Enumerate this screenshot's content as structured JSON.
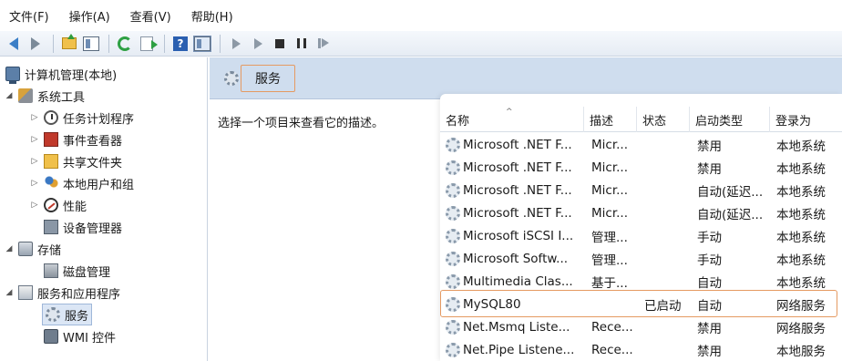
{
  "menu": [
    "文件(F)",
    "操作(A)",
    "查看(V)",
    "帮助(H)"
  ],
  "tree": {
    "root": "计算机管理(本地)",
    "system_tools": "系统工具",
    "task_scheduler": "任务计划程序",
    "event_viewer": "事件查看器",
    "shared_folders": "共享文件夹",
    "local_users": "本地用户和组",
    "performance": "性能",
    "device_manager": "设备管理器",
    "storage": "存储",
    "disk_management": "磁盘管理",
    "services_apps": "服务和应用程序",
    "services": "服务",
    "wmi": "WMI 控件"
  },
  "header": {
    "title": "服务"
  },
  "description_hint": "选择一个项目来查看它的描述。",
  "columns": {
    "name": "名称",
    "description": "描述",
    "status": "状态",
    "startup": "启动类型",
    "logon": "登录为"
  },
  "rows": [
    {
      "name": "Microsoft .NET F...",
      "desc": "Micr...",
      "status": "",
      "startup": "禁用",
      "logon": "本地系统"
    },
    {
      "name": "Microsoft .NET F...",
      "desc": "Micr...",
      "status": "",
      "startup": "禁用",
      "logon": "本地系统"
    },
    {
      "name": "Microsoft .NET F...",
      "desc": "Micr...",
      "status": "",
      "startup": "自动(延迟...",
      "logon": "本地系统"
    },
    {
      "name": "Microsoft .NET F...",
      "desc": "Micr...",
      "status": "",
      "startup": "自动(延迟...",
      "logon": "本地系统"
    },
    {
      "name": "Microsoft iSCSI I...",
      "desc": "管理...",
      "status": "",
      "startup": "手动",
      "logon": "本地系统"
    },
    {
      "name": "Microsoft Softw...",
      "desc": "管理...",
      "status": "",
      "startup": "手动",
      "logon": "本地系统"
    },
    {
      "name": "Multimedia Clas...",
      "desc": "基于...",
      "status": "",
      "startup": "自动",
      "logon": "本地系统"
    },
    {
      "name": "MySQL80",
      "desc": "",
      "status": "已启动",
      "startup": "自动",
      "logon": "网络服务"
    },
    {
      "name": "Net.Msmq Liste...",
      "desc": "Rece...",
      "status": "",
      "startup": "禁用",
      "logon": "网络服务"
    },
    {
      "name": "Net.Pipe Listene...",
      "desc": "Rece...",
      "status": "",
      "startup": "禁用",
      "logon": "本地服务"
    }
  ],
  "colors": {
    "header_strip": "#cfddee",
    "highlight_border": "#e59a62",
    "selected_bg": "#dbe6f5"
  }
}
